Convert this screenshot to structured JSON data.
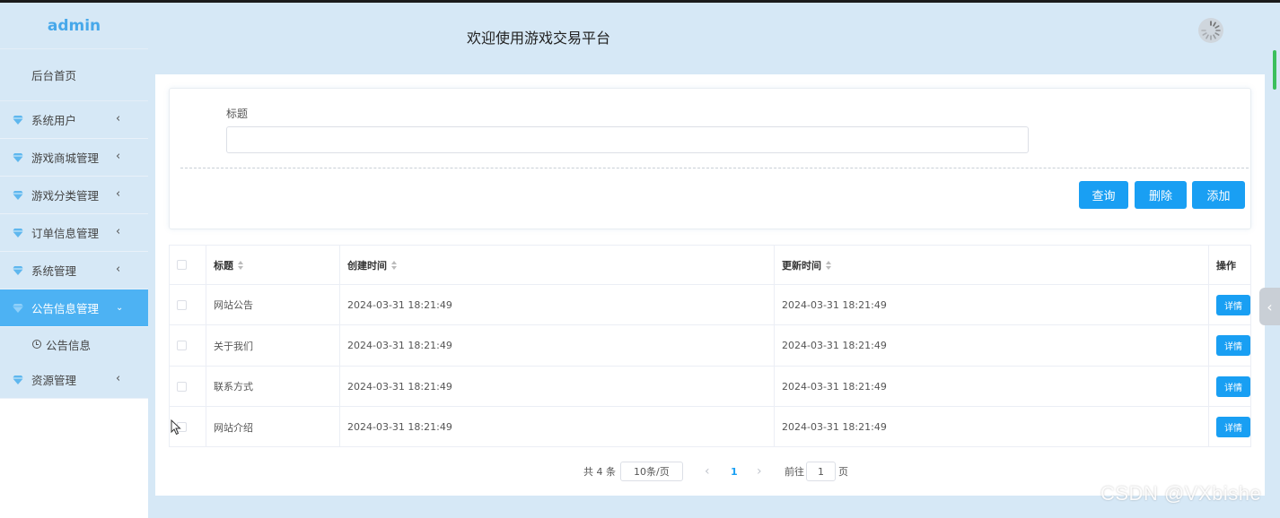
{
  "sidebar": {
    "brand": "admin",
    "home": "后台首页",
    "items": [
      {
        "label": "系统用户"
      },
      {
        "label": "游戏商城管理"
      },
      {
        "label": "游戏分类管理"
      },
      {
        "label": "订单信息管理"
      },
      {
        "label": "系统管理"
      },
      {
        "label": "公告信息管理"
      },
      {
        "label": "资源管理"
      }
    ],
    "active_sub": "公告信息",
    "icon": "diamond-icon",
    "accent": "#4db2f3"
  },
  "header": {
    "title": "欢迎使用游戏交易平台",
    "avatar_icon": "spinner-avatar-icon"
  },
  "search": {
    "label": "标题",
    "value": "",
    "placeholder": "",
    "buttons": {
      "query": "查询",
      "delete": "删除",
      "add": "添加"
    },
    "button_color": "#199ff3"
  },
  "table": {
    "columns": [
      "标题",
      "创建时间",
      "更新时间",
      "操作"
    ],
    "rows": [
      {
        "title": "网站公告",
        "created": "2024-03-31 18:21:49",
        "updated": "2024-03-31 18:21:49",
        "action": "详情"
      },
      {
        "title": "关于我们",
        "created": "2024-03-31 18:21:49",
        "updated": "2024-03-31 18:21:49",
        "action": "详情"
      },
      {
        "title": "联系方式",
        "created": "2024-03-31 18:21:49",
        "updated": "2024-03-31 18:21:49",
        "action": "详情"
      },
      {
        "title": "网站介绍",
        "created": "2024-03-31 18:21:49",
        "updated": "2024-03-31 18:21:49",
        "action": "详情"
      }
    ]
  },
  "pagination": {
    "total": "共 4 条",
    "page_size": "10条/页",
    "prev": "‹",
    "current": "1",
    "next": "›",
    "goto_prefix": "前往",
    "goto_value": "1",
    "goto_suffix": "页"
  },
  "watermark": "CSDN @VXbishe"
}
